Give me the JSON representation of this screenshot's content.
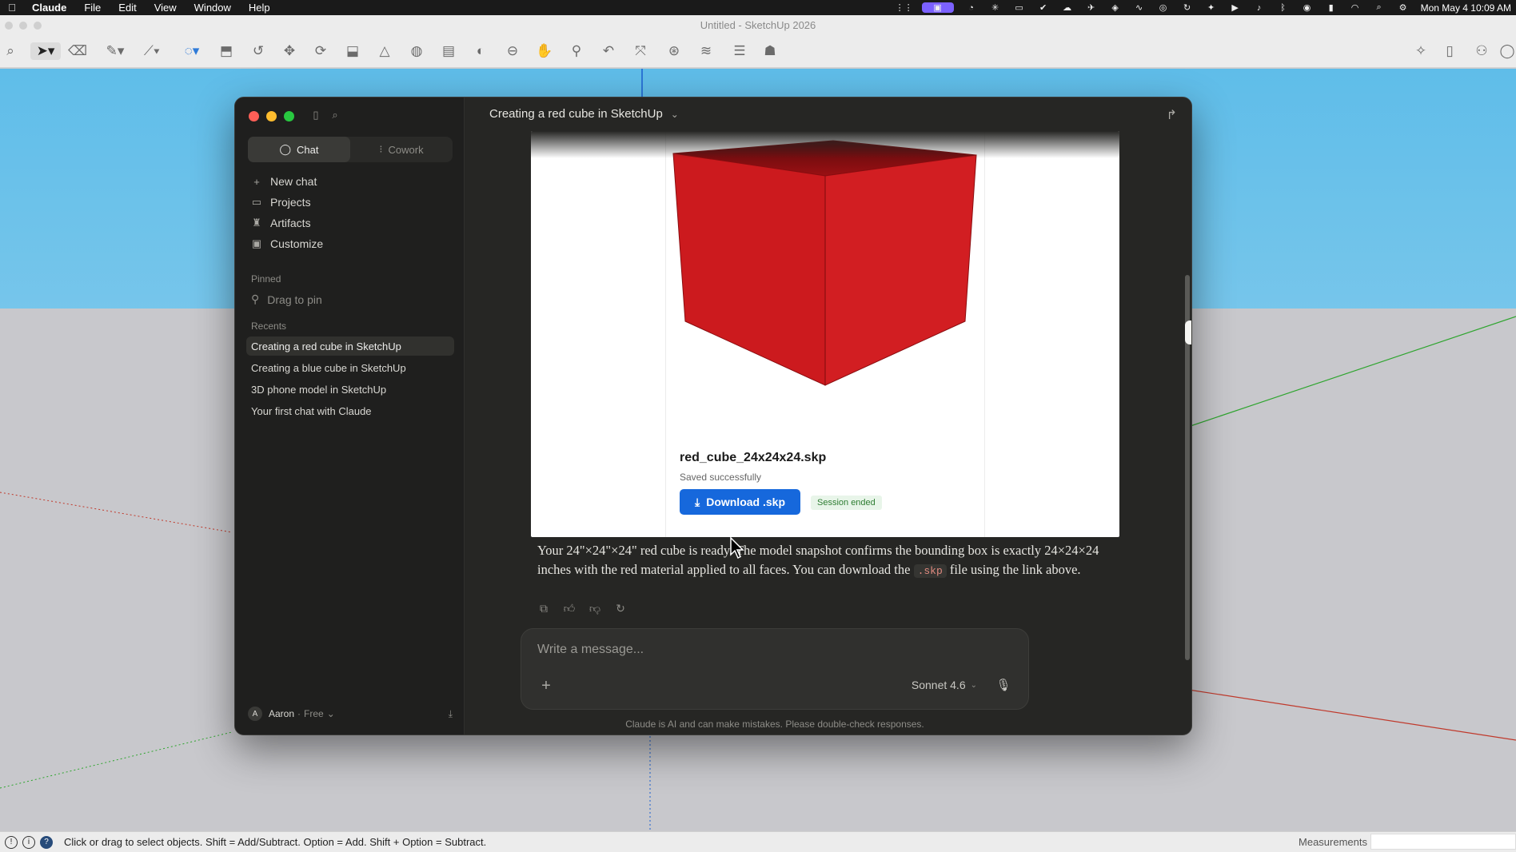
{
  "menubar": {
    "app_name": "Claude",
    "items": [
      "File",
      "Edit",
      "View",
      "Window",
      "Help"
    ],
    "datetime": "Mon May 4  10:09 AM"
  },
  "sketchup": {
    "window_title": "Untitled - SketchUp 2026",
    "status_text": "Click or drag to select objects. Shift = Add/Subtract. Option = Add. Shift + Option = Subtract.",
    "measurements_label": "Measurements",
    "measurements_value": ""
  },
  "claude": {
    "mode_tabs": [
      {
        "label": "Chat",
        "active": true
      },
      {
        "label": "Cowork",
        "active": false
      }
    ],
    "nav": [
      {
        "label": "New chat",
        "icon": "plus-icon"
      },
      {
        "label": "Projects",
        "icon": "folder-icon"
      },
      {
        "label": "Artifacts",
        "icon": "artifacts-icon"
      },
      {
        "label": "Customize",
        "icon": "briefcase-icon"
      }
    ],
    "pinned_label": "Pinned",
    "drag_to_pin": "Drag to pin",
    "recents_label": "Recents",
    "recents": [
      "Creating a red cube in SketchUp",
      "Creating a blue cube in SketchUp",
      "3D phone model in SketchUp",
      "Your first chat with Claude"
    ],
    "user_name": "Aaron",
    "user_plan": "Free",
    "user_initial": "A",
    "chat_title": "Creating a red cube in SketchUp",
    "artifact": {
      "file_name": "red_cube_24x24x24.skp",
      "status": "Saved successfully",
      "download_label": "Download .skp",
      "session_badge": "Session ended",
      "cube_color": "#cc1a1e"
    },
    "reply": {
      "text_before_code": "Your 24\"×24\"×24\" red cube is ready. The model snapshot confirms the bounding box is exactly 24×24×24 inches with the red material applied to all faces. You can download the ",
      "code": ".skp",
      "text_after_code": " file using the link above."
    },
    "composer": {
      "placeholder": "Write a message...",
      "model": "Sonnet 4.6"
    },
    "disclaimer": "Claude is AI and can make mistakes. Please double-check responses."
  },
  "colors": {
    "accent_blue": "#1668dc",
    "sky": "#5fbde9",
    "ground": "#c8c8cc",
    "claude_bg": "#262624"
  }
}
